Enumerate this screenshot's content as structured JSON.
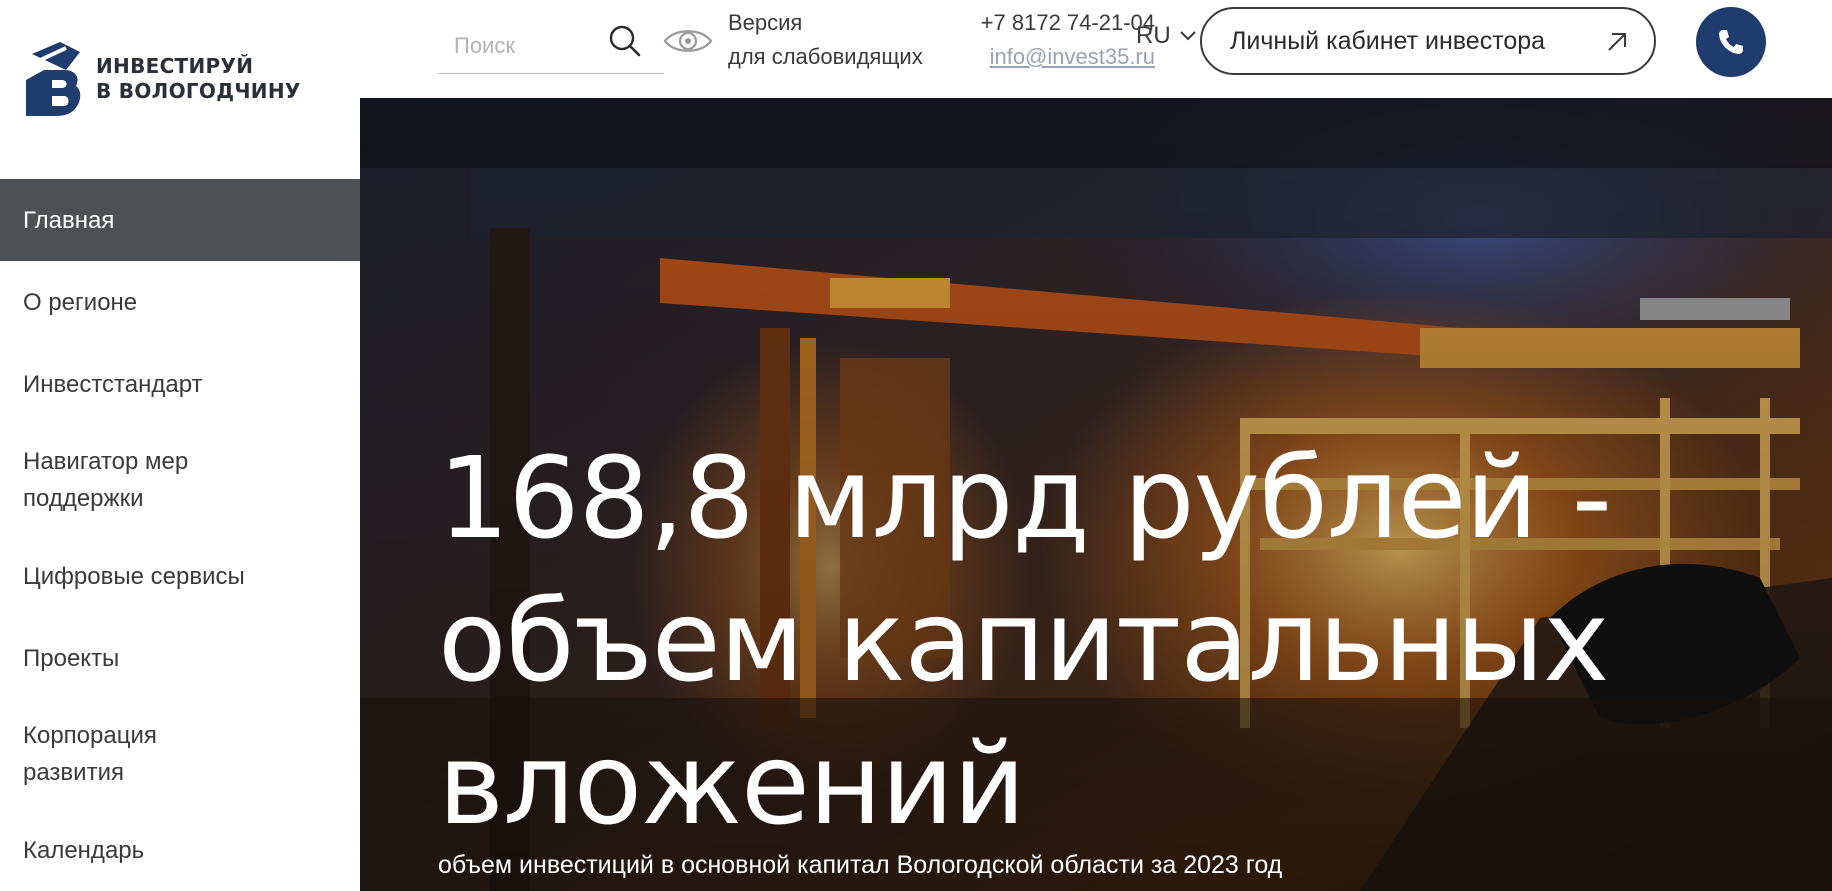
{
  "logo": {
    "line1": "ИНВЕСТИРУЙ",
    "line2": "В ВОЛОГОДЧИНУ",
    "color": "#1f3c6e"
  },
  "nav": {
    "items": [
      {
        "label": "Главная",
        "active": true
      },
      {
        "label": "О регионе"
      },
      {
        "label": "Инвестстандарт"
      },
      {
        "label": "Навигатор мер поддержки"
      },
      {
        "label": "Цифровые сервисы"
      },
      {
        "label": "Проекты"
      },
      {
        "label": "Корпорация развития"
      },
      {
        "label": "Календарь"
      }
    ]
  },
  "header": {
    "search_placeholder": "Поиск",
    "vision_line1": "Версия",
    "vision_line2": "для слабовидящих",
    "phone": "+7 8172 74-21-04",
    "email": "info@invest35.ru",
    "lang": "RU",
    "cabinet_label": "Личный кабинет инвестора",
    "call_button_color": "#1f3c6e"
  },
  "hero": {
    "title_line1": "168,8 млрд рублей -",
    "title_line2": "объем капитальных",
    "title_line3": "вложений",
    "subtitle": "объем инвестиций в основной капитал Вологодской области за 2023 год"
  }
}
